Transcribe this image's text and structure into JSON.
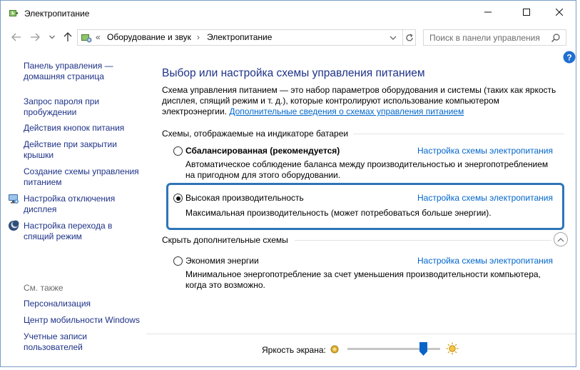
{
  "window": {
    "title": "Электропитание",
    "controls": {
      "minimize": "minimize",
      "maximize": "maximize",
      "close": "close"
    }
  },
  "address": {
    "separator": "«",
    "crumbs": [
      "Оборудование и звук",
      "Электропитание"
    ],
    "crumb_sep": "›",
    "search_placeholder": "Поиск в панели управления"
  },
  "sidebar": {
    "links": [
      {
        "label": "Панель управления —\nдомашняя страница",
        "icon": ""
      },
      {
        "label": "Запрос пароля при\nпробуждении",
        "icon": ""
      },
      {
        "label": "Действия кнопок питания",
        "icon": ""
      },
      {
        "label": "Действие при закрытии\nкрышки",
        "icon": ""
      },
      {
        "label": "Создание схемы управления\nпитанием",
        "icon": ""
      },
      {
        "label": "Настройка отключения\nдисплея",
        "icon": "monitor-icon"
      },
      {
        "label": "Настройка перехода в\nспящий режим",
        "icon": "moon-icon"
      }
    ],
    "see_also": "См. также",
    "see_also_links": [
      "Персонализация",
      "Центр мобильности Windows",
      "Учетные записи\nпользователей"
    ]
  },
  "main": {
    "title": "Выбор или настройка схемы управления питанием",
    "description": "Схема управления питанием — это набор параметров оборудования и системы (таких как яркость дисплея, спящий режим и т. д.), которые контролируют использование компьютером электроэнергии.",
    "description_link": "Дополнительные сведения о схемах управления питанием",
    "group_header": "Схемы, отображаемые на индикаторе батареи",
    "plans": [
      {
        "name": "Сбалансированная (рекомендуется)",
        "link": "Настройка схемы электропитания",
        "desc": "Автоматическое соблюдение баланса между производительностью и энергопотреблением на пригодном для этого оборудовании.",
        "selected": false
      },
      {
        "name": "Высокая производительность",
        "link": "Настройка схемы электропитания",
        "desc": "Максимальная производительность (может потребоваться больше энергии).",
        "selected": true
      }
    ],
    "hidden_header": "Скрыть дополнительные схемы",
    "hidden_plans": [
      {
        "name": "Экономия энергии",
        "link": "Настройка схемы электропитания",
        "desc": "Минимальное энергопотребление за счет уменьшения производительности компьютера, когда это возможно.",
        "selected": false
      }
    ]
  },
  "brightness": {
    "label": "Яркость экрана:",
    "level_percent": 82
  },
  "colors": {
    "link": "#0066cc",
    "nav_link": "#1e3287",
    "highlight": "#2e75b6"
  }
}
